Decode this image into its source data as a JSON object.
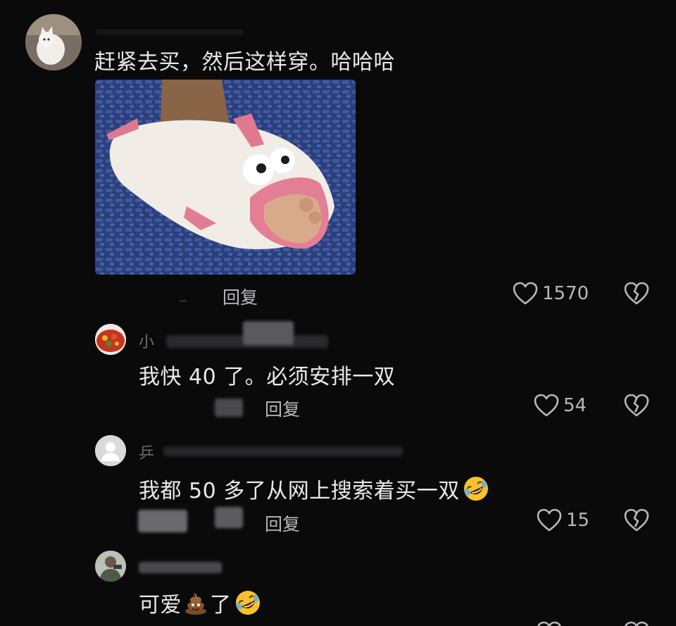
{
  "comments": [
    {
      "text": "赶紧去买，然后这样穿。哈哈哈",
      "reply_label": "回复",
      "likes": "1570"
    },
    {
      "name_visible": "小",
      "text": "我快 40 了。必须安排一双",
      "reply_label": "回复",
      "likes": "54"
    },
    {
      "name_visible": "乒",
      "text": "我都 50 多了从网上搜索着买一双",
      "reply_label": "回复",
      "likes": "15"
    },
    {
      "text": "可爱",
      "text_after": "了"
    }
  ],
  "icons": {
    "like": "heart-outline-icon",
    "dislike": "broken-heart-icon",
    "laugh": "rolling-laughing-emoji",
    "poop": "poop-emoji"
  },
  "colors": {
    "background": "#0a0a0b",
    "text": "#e9e9ea",
    "muted": "#b8b8bb"
  }
}
